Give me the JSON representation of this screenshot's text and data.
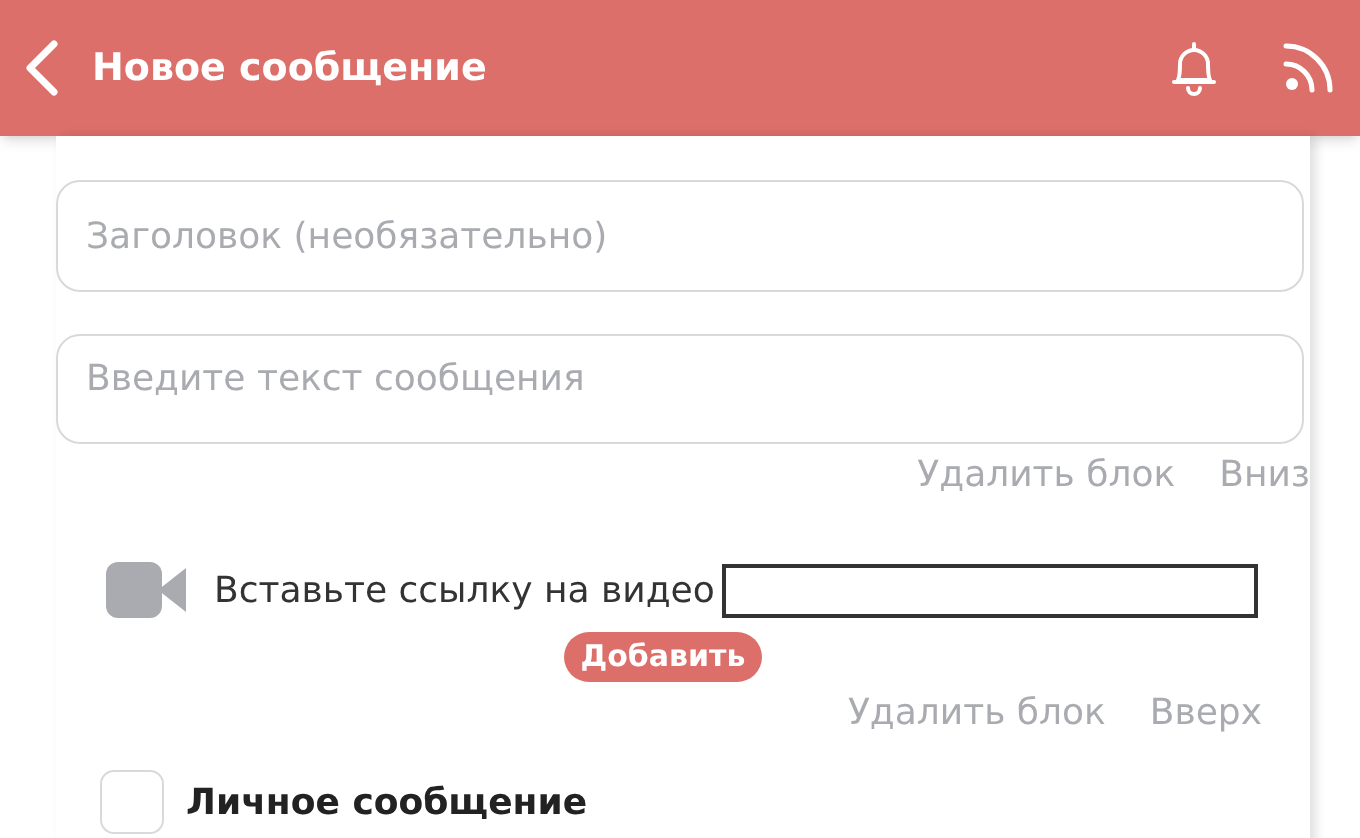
{
  "header": {
    "title": "Новое сообщение"
  },
  "title_field": {
    "placeholder": "Заголовок (необязательно)"
  },
  "text_block": {
    "placeholder": "Введите текст сообщения",
    "actions": [
      "Удалить блок",
      "Вниз"
    ]
  },
  "video_block": {
    "label": "Вставьте ссылку на видео",
    "add_button": "Добавить",
    "actions": [
      "Удалить блок",
      "Вверх"
    ]
  },
  "private_message": {
    "label": "Личное сообщение",
    "checked": false
  }
}
